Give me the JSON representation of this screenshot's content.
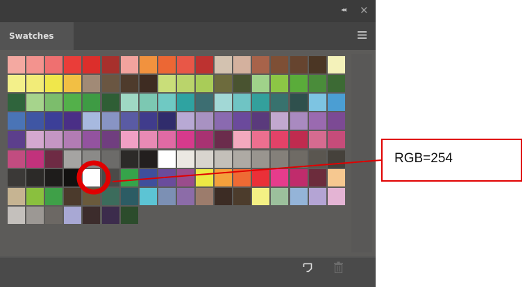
{
  "panel": {
    "tab_label": "Swatches",
    "collapse_glyph": "◂◂",
    "close_glyph": "✕",
    "icons": {
      "panel_menu": "hamburger-menu-icon",
      "new_swatch": "new-swatch-icon",
      "delete_swatch": "trash-icon"
    }
  },
  "callout": {
    "label": "RGB=254",
    "color": "#e00000"
  },
  "swatch_rows": [
    [
      "#f4a9a1",
      "#f3938e",
      "#ef7070",
      "#ea3d39",
      "#dc2e2b",
      "#a7302c",
      "#f2a39e",
      "#f1923e",
      "#ec6734",
      "#e85747",
      "#bd3230",
      "#d3c2b0",
      "#d4b19e",
      "#a8634a",
      "#7e4f35",
      "#66442f",
      "#4b3624",
      "#f4f2ba"
    ],
    [
      "#f3f08a",
      "#f2ec78",
      "#f0e74b",
      "#f2bf44",
      "#a18a76",
      "#6a5642",
      "#4e3b2c",
      "#3e2c22",
      "#c9de79",
      "#bad46b",
      "#a9cc58",
      "#6d6b3d",
      "#495330",
      "#a0d28a",
      "#8cc645",
      "#5aac3a",
      "#4a8c3a",
      "#3c6a34"
    ],
    [
      "#2f643c",
      "#a6d48c",
      "#7cbd6c",
      "#53b04a",
      "#3e9b44",
      "#2f5e35",
      "#9fd8c4",
      "#7cc8b2",
      "#6fc9c3",
      "#2fa3a1",
      "#3d6e72",
      "#a2d8d6",
      "#6fc4c4",
      "#33a09c",
      "#38726e",
      "#2f504d",
      "#7dc4e2",
      "#4b9ed3"
    ],
    [
      "#4a74b6",
      "#3f56a4",
      "#3c3f98",
      "#4a2f86",
      "#a7b9df",
      "#8894c4",
      "#5a5ba4",
      "#403c8c",
      "#302c6c",
      "#b8a9d4",
      "#a892c2",
      "#8a6ab0",
      "#6b4a9c",
      "#5a3a7c",
      "#c2a8cf",
      "#a98ac0",
      "#9a6ab0",
      "#7c4a94"
    ],
    [
      "#5c3f8c",
      "#d4a8d0",
      "#c496c4",
      "#b27cb4",
      "#93539f",
      "#703e7f",
      "#f1a0c4",
      "#e88ab4",
      "#e06aa4",
      "#d63a8c",
      "#a83272",
      "#6b2c4c",
      "#f3a9be",
      "#ec6f8f",
      "#e34268",
      "#c02b4f",
      "#d56b90",
      "#c64c7a"
    ],
    [
      "#c24c80",
      "#c2327c",
      "#6e2b44",
      "#a5a4a2",
      "#8b8a88",
      "#6c6b69",
      "#2c2a28",
      "#231f1e",
      "#ffffff",
      "#ebe8e2",
      "#d8d4ce",
      "#c3bfb9",
      "#aeaaa4",
      "#99958f",
      "#84807a",
      "#6f6b65",
      "#5a5650",
      "#45413b"
    ],
    [
      "#3b3937",
      "#2c2a28",
      "#1e1c1b",
      "#121110",
      "#fefefe",
      "#4b4a48",
      "#35a44a",
      "#3f4f9c",
      "#6a4c9c",
      "#9a4c8c",
      "#ece844",
      "#f4a03c",
      "#ee6a34",
      "#ea3038",
      "#e63c8c",
      "#c02c6c",
      "#6c2c3c",
      "#f6c890"
    ],
    [
      "#c6b492",
      "#8ac03e",
      "#3fa048",
      "#4b3a2c",
      "#6a5a3c",
      "#3c6c5c",
      "#2c5c64",
      "#5cc4d4",
      "#7c90b4",
      "#8c6ca8",
      "#9c7c6c",
      "#3c2c24",
      "#4c3c2c",
      "#f4f084",
      "#9cc09c",
      "#94b4d8",
      "#b4a4d4",
      "#e4b4d4"
    ],
    [
      "#c4c0bc",
      "#9c9894",
      "#6c6864",
      "#a8a8d4",
      "#3c2c2c",
      "#3c2c4c",
      "#2c4c2c"
    ]
  ]
}
